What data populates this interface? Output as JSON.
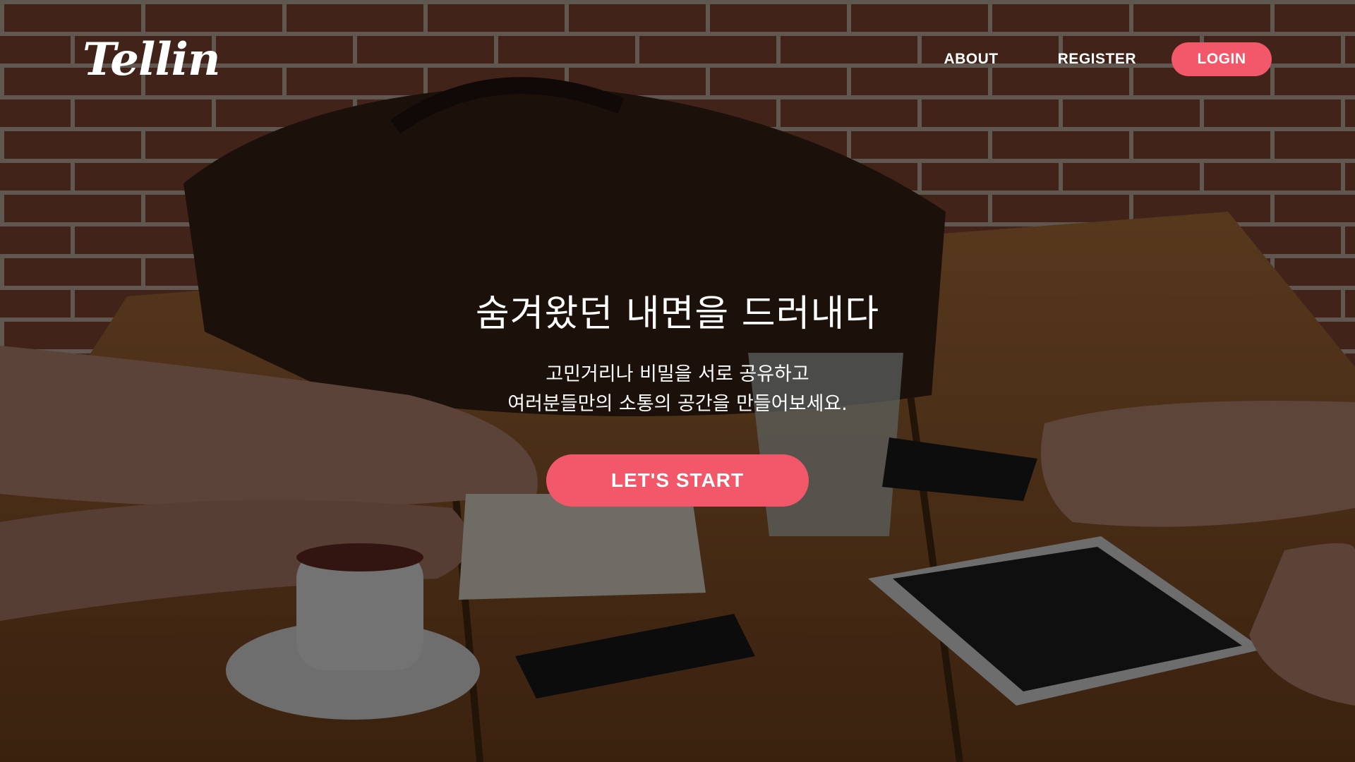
{
  "brand": {
    "logo_text": "Tellin"
  },
  "nav": {
    "about": "ABOUT",
    "register": "REGISTER",
    "login": "LOGIN"
  },
  "hero": {
    "headline": "숨겨왔던 내면을 드러내다",
    "sub_line1": "고민거리나 비밀을 서로 공유하고",
    "sub_line2": "여러분들만의 소통의 공간을 만들어보세요.",
    "cta": "LET'S START"
  },
  "colors": {
    "accent": "#f2586a",
    "text": "#ffffff",
    "overlay": "rgba(0,0,0,0.52)"
  }
}
